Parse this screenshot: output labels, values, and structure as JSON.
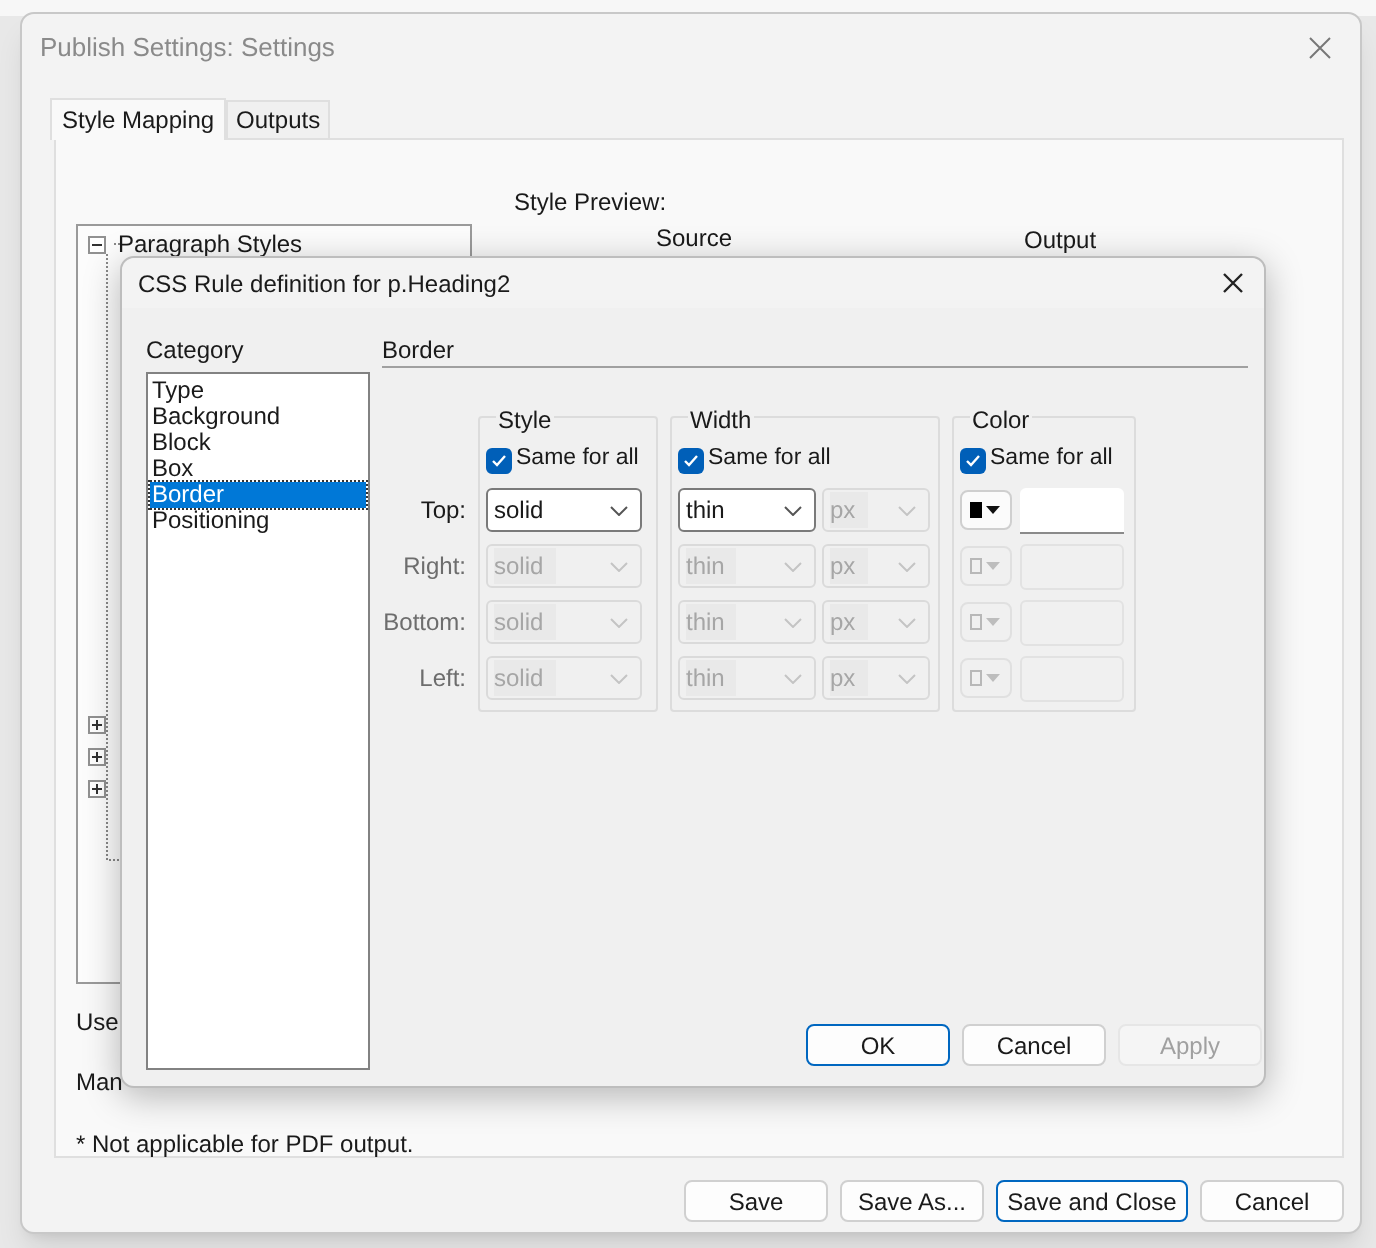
{
  "window": {
    "title": "Publish Settings: Settings"
  },
  "tabs": [
    {
      "label": "Style Mapping",
      "selected": true
    },
    {
      "label": "Outputs",
      "selected": false
    }
  ],
  "style_tree": {
    "label": "Paragraph Styles",
    "expanded": true,
    "children": [
      {
        "expanded": false
      },
      {
        "expanded": false
      },
      {
        "expanded": false
      }
    ]
  },
  "style_preview": {
    "label": "Style Preview:",
    "columns": [
      "Source",
      "Output"
    ]
  },
  "partial_labels": [
    "Use",
    "Man"
  ],
  "footnote": "* Not applicable for PDF output.",
  "buttons": [
    {
      "label": "Save",
      "default": false
    },
    {
      "label": "Save As...",
      "default": false
    },
    {
      "label": "Save and Close",
      "default": true
    },
    {
      "label": "Cancel",
      "default": false
    }
  ],
  "css_dialog": {
    "title": "CSS Rule definition for p.Heading2",
    "category_label": "Category",
    "categories": [
      {
        "label": "Type",
        "selected": false
      },
      {
        "label": "Background",
        "selected": false
      },
      {
        "label": "Block",
        "selected": false
      },
      {
        "label": "Box",
        "selected": false
      },
      {
        "label": "Border",
        "selected": true
      },
      {
        "label": "Positioning",
        "selected": false
      }
    ],
    "section_title": "Border",
    "groups": [
      {
        "title": "Style",
        "same_for_all": true,
        "checkbox_label": "Same for all"
      },
      {
        "title": "Width",
        "same_for_all": true,
        "checkbox_label": "Same for all"
      },
      {
        "title": "Color",
        "same_for_all": true,
        "checkbox_label": "Same for all"
      }
    ],
    "rows": [
      {
        "label": "Top:",
        "disabled": false,
        "style": "solid",
        "width": "thin",
        "unit": "px",
        "unit_disabled": true,
        "color": "#000000"
      },
      {
        "label": "Right:",
        "disabled": true,
        "style": "solid",
        "width": "thin",
        "unit": "px",
        "unit_disabled": true
      },
      {
        "label": "Bottom:",
        "disabled": true,
        "style": "solid",
        "width": "thin",
        "unit": "px",
        "unit_disabled": true
      },
      {
        "label": "Left:",
        "disabled": true,
        "style": "solid",
        "width": "thin",
        "unit": "px",
        "unit_disabled": true
      }
    ],
    "buttons": [
      {
        "label": "OK",
        "default": true,
        "disabled": false
      },
      {
        "label": "Cancel",
        "default": false,
        "disabled": false
      },
      {
        "label": "Apply",
        "default": false,
        "disabled": true
      }
    ]
  }
}
